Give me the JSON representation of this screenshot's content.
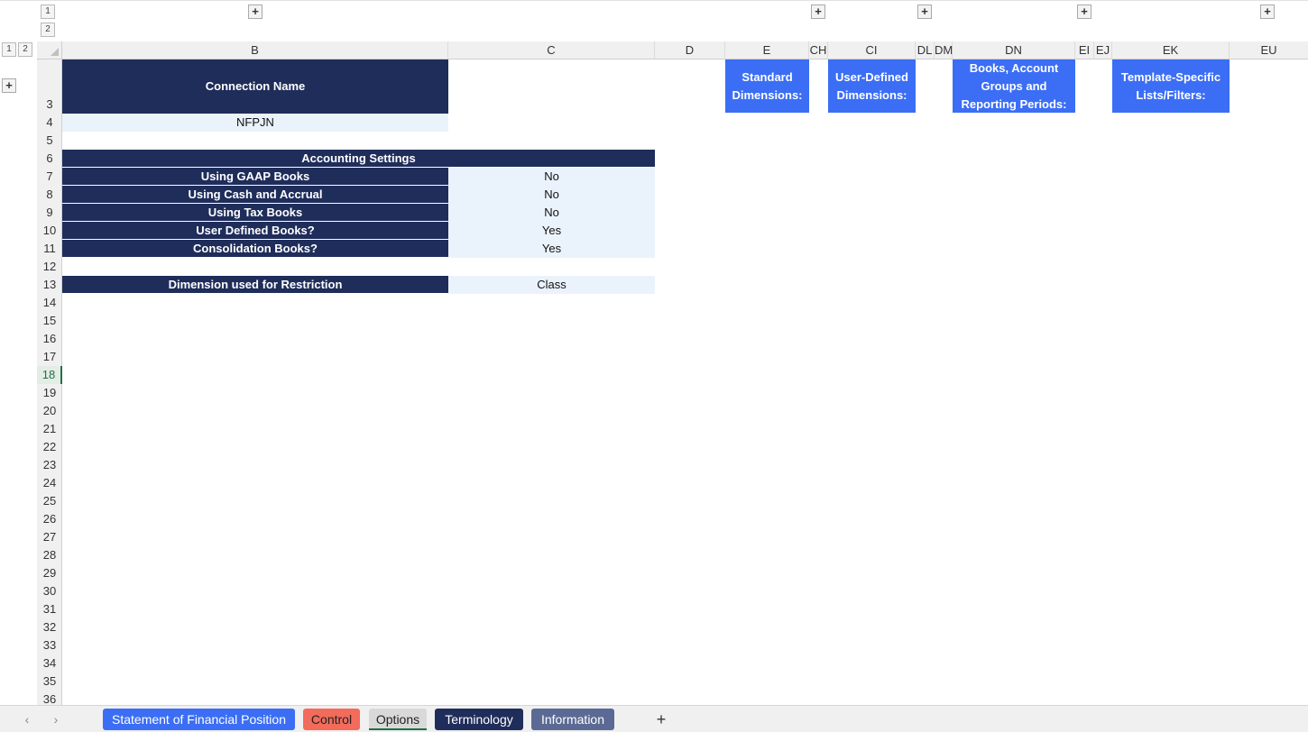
{
  "outline": {
    "col_levels": [
      "1",
      "2"
    ],
    "row_levels": [
      "1",
      "2"
    ],
    "expand_symbol": "+"
  },
  "columns": [
    "B",
    "C",
    "D",
    "E",
    "CH",
    "CI",
    "DL",
    "DM",
    "DN",
    "EI",
    "EJ",
    "EK",
    "EU"
  ],
  "rows": [
    "3",
    "4",
    "5",
    "6",
    "7",
    "8",
    "9",
    "10",
    "11",
    "12",
    "13",
    "14",
    "15",
    "16",
    "17",
    "18",
    "19",
    "20",
    "21",
    "22",
    "23",
    "24",
    "25",
    "26",
    "27",
    "28",
    "29",
    "30",
    "31",
    "32",
    "33",
    "34",
    "35",
    "36"
  ],
  "selected_row": "18",
  "sheet": {
    "connection_header": "Connection Name",
    "connection_value": "NFPJN",
    "accounting_header": "Accounting Settings",
    "settings": [
      {
        "label": "Using GAAP Books",
        "value": "No"
      },
      {
        "label": "Using Cash and Accrual",
        "value": "No"
      },
      {
        "label": "Using Tax Books",
        "value": "No"
      },
      {
        "label": "User Defined Books?",
        "value": "Yes"
      },
      {
        "label": "Consolidation Books?",
        "value": "Yes"
      }
    ],
    "restriction_label": "Dimension used for Restriction",
    "restriction_value": "Class",
    "group_headers": {
      "standard": "Standard Dimensions:",
      "user_defined": "User-Defined Dimensions:",
      "books": "Books, Account Groups and Reporting Periods:",
      "template": "Template-Specific Lists/Filters:"
    }
  },
  "tabs": [
    {
      "label": "Statement of Financial Position",
      "color": "#3b6ef5"
    },
    {
      "label": "Control",
      "color": "#f26b5b"
    },
    {
      "label": "Options",
      "color": "#d9d9d9"
    },
    {
      "label": "Terminology",
      "color": "#1f2d5a"
    },
    {
      "label": "Information",
      "color": "#5b6a94"
    }
  ],
  "tab_nav": {
    "prev": "‹",
    "next": "›",
    "add": "+"
  },
  "colors": {
    "navy": "#1f2d5a",
    "blue": "#3b6ef5",
    "light": "#eaf3fc"
  }
}
